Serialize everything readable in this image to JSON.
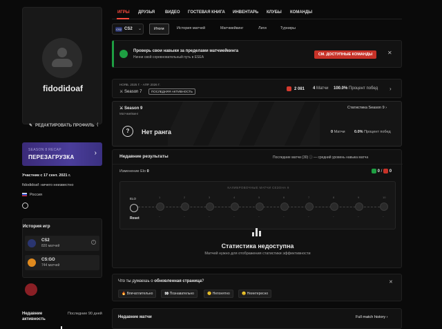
{
  "profile": {
    "username": "fidodidoaf",
    "edit_label": "РЕДАКТИРОВАТЬ ПРОФИЛЬ",
    "share_label": "ПОДЕЛИТЬСЯ",
    "recap_small": "SEASON 8 RECAP",
    "recap_big": "ПЕРЕЗАГРУЗКА",
    "member_since": "Участник с 17 сент. 2021 г.",
    "bio": "fidodidoaf: ничего неизвестно",
    "country": "Россия",
    "history_title": "История игр",
    "games": [
      {
        "name": "CS2",
        "matches": "820 матчей",
        "color": "#2a3570"
      },
      {
        "name": "CS:GO",
        "matches": "744 матчей",
        "color": "#e08a1e"
      }
    ],
    "recent_activity": "Недавние активность",
    "recent_period": "Последние 90 дней"
  },
  "nav": {
    "tabs": [
      "ИГРЫ",
      "ДРУЗЬЯ",
      "ВИДЕО",
      "ГОСТЕВАЯ КНИГА",
      "ИНВЕНТАРЬ",
      "КЛУБЫ",
      "КОМАНДЫ"
    ],
    "active": "ИГРЫ"
  },
  "subnav": {
    "game": "CS2",
    "game_logo": "CS2",
    "tabs": [
      "Итоги",
      "История матчей",
      "Матчмейкинг",
      "Лиги",
      "Турниры"
    ]
  },
  "faceit": {
    "title": "Проверь свои навыки за пределами матчмейкинга",
    "subtitle": "Начни свой соревновательный путь в ESEA",
    "button": "СМ. ДОСТУПНЫЕ КОМАНДЫ",
    "accent": "#1e9e42"
  },
  "season7": {
    "dates": "НОЯБ. 2025 Г. - АПР. 2026 Г.",
    "name": "Season 7",
    "tag": "ПОСЛЕДНЯЯ АКТИВНОСТЬ",
    "elo": "2 081",
    "matches_value": "4",
    "matches_label": "Матчи",
    "winrate_value": "100.0%",
    "winrate_label": "Процент побед"
  },
  "season9": {
    "title": "Season 9",
    "subtitle": "Матчмейкинг",
    "stats_link": "Статистика Season 9",
    "rank_text": "Нет ранга",
    "matches_value": "0",
    "matches_label": "Матчи",
    "winrate_value": "0.0%",
    "winrate_label": "Процент побед"
  },
  "results": {
    "title": "Недавние результаты",
    "last_matches": "Последние матчи (30)",
    "avg_skill": "— средний уровень навыка матча",
    "elo_label": "Изменение Elo",
    "elo_value": "0",
    "wins": "0",
    "losses": "0",
    "track_title": "КАЛИБРОВОЧНЫЕ МАТЧИ СЕЗОНА 9",
    "elo_node": "ELO",
    "reset": "Reset",
    "nodes": [
      "1",
      "2",
      "3",
      "4",
      "5",
      "6",
      "7",
      "8",
      "9",
      "10"
    ],
    "empty_title": "Статистика недоступна",
    "empty_sub": "Матчей нужно для отображения статистики эффективности"
  },
  "feedback": {
    "question_pre": "Что ты думаешь о ",
    "question_bold": "обновленная страница",
    "question_post": "?",
    "options": [
      "🔥 Впечатлительно",
      "👀 Познавательно",
      "😕 Непонятно",
      "😐 Неинтересно"
    ]
  },
  "recent_matches": {
    "title": "Недавние матчи",
    "link": "Full match history"
  }
}
